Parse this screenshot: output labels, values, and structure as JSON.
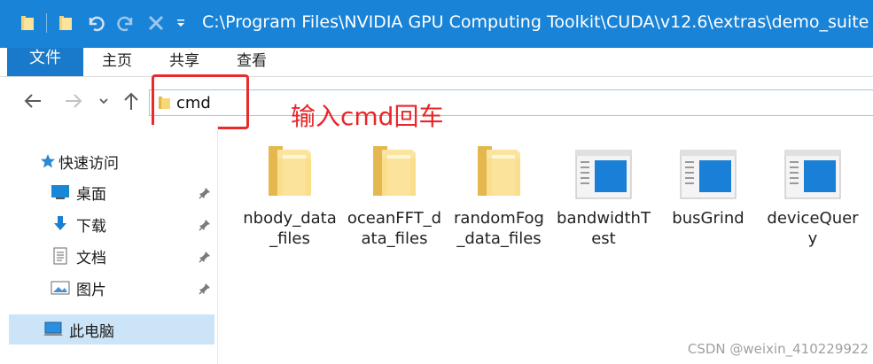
{
  "window": {
    "path": "C:\\Program Files\\NVIDIA GPU Computing Toolkit\\CUDA\\v12.6\\extras\\demo_suite"
  },
  "ribbon": {
    "tabs": [
      "文件",
      "主页",
      "共享",
      "查看"
    ]
  },
  "address_bar": {
    "value": "cmd"
  },
  "annotation": "输入cmd回车",
  "sidebar": {
    "quick_access": "快速访问",
    "items": [
      {
        "label": "桌面",
        "icon": "desktop-icon",
        "pinned": true
      },
      {
        "label": "下载",
        "icon": "download-icon",
        "pinned": true
      },
      {
        "label": "文档",
        "icon": "document-icon",
        "pinned": true
      },
      {
        "label": "图片",
        "icon": "pictures-icon",
        "pinned": true
      }
    ],
    "this_pc": "此电脑"
  },
  "files": [
    {
      "name": "nbody_data_files",
      "type": "folder"
    },
    {
      "name": "oceanFFT_data_files",
      "type": "folder"
    },
    {
      "name": "randomFog_data_files",
      "type": "folder"
    },
    {
      "name": "bandwidthTest",
      "type": "exe"
    },
    {
      "name": "busGrind",
      "type": "exe"
    },
    {
      "name": "deviceQuery",
      "type": "exe"
    }
  ],
  "watermark": "CSDN @weixin_410229922",
  "colors": {
    "titlebar": "#1883d7",
    "file_tab": "#1979ca",
    "annotation": "#e8262a",
    "selected": "#cce4f7"
  }
}
